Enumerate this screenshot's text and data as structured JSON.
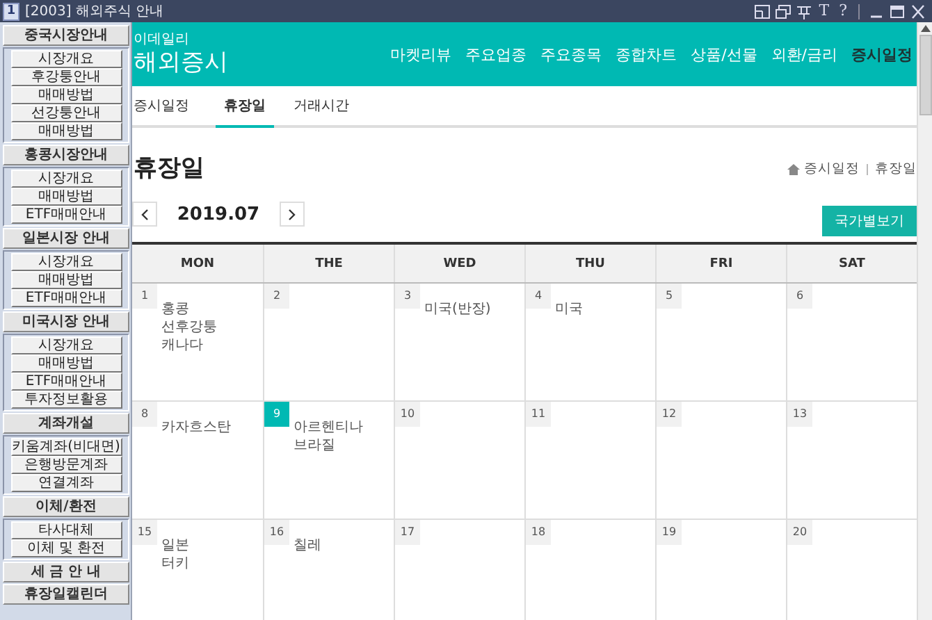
{
  "window": {
    "icon_label": "1",
    "title": "[2003] 해외주식 안내",
    "tool_buttons": [
      "T",
      "?"
    ]
  },
  "sidebar": {
    "sections": [
      {
        "label": "중국시장안내",
        "items": [
          "시장개요",
          "후강퉁안내",
          "매매방법",
          "선강퉁안내",
          "매매방법"
        ]
      },
      {
        "label": "홍콩시장안내",
        "items": [
          "시장개요",
          "매매방법",
          "ETF매매안내"
        ]
      },
      {
        "label": "일본시장 안내",
        "items": [
          "시장개요",
          "매매방법",
          "ETF매매안내"
        ]
      },
      {
        "label": "미국시장 안내",
        "items": [
          "시장개요",
          "매매방법",
          "ETF매매안내",
          "투자정보활용"
        ]
      },
      {
        "label": "계좌개설",
        "items": [
          "키움계좌(비대면)",
          "은행방문계좌",
          "연결계좌"
        ]
      },
      {
        "label": "이체/환전",
        "items": [
          "타사대체",
          "이체 및 환전"
        ]
      },
      {
        "label": "세 금 안 내"
      },
      {
        "label": "휴장일캘린더"
      }
    ]
  },
  "header": {
    "brand_small": "이데일리",
    "brand": "해외증시",
    "nav": [
      {
        "label": "마켓리뷰",
        "selected": false
      },
      {
        "label": "주요업종",
        "selected": false
      },
      {
        "label": "주요종목",
        "selected": false
      },
      {
        "label": "종합차트",
        "selected": false
      },
      {
        "label": "상품/선물",
        "selected": false
      },
      {
        "label": "외환/금리",
        "selected": false
      },
      {
        "label": "증시일정",
        "selected": true
      }
    ]
  },
  "subtabs": [
    {
      "label": "증시일정",
      "selected": false
    },
    {
      "label": "휴장일",
      "selected": true
    },
    {
      "label": "거래시간",
      "selected": false
    }
  ],
  "page_title": "휴장일",
  "breadcrumb": [
    "증시일정",
    "휴장일"
  ],
  "month": "2019.07",
  "country_button": "국가별보기",
  "calendar": {
    "columns": [
      "MON",
      "THE",
      "WED",
      "THU",
      "FRI",
      "SAT"
    ],
    "weeks": [
      [
        {
          "day": "1",
          "today": false,
          "events": [
            "홍콩",
            "선후강퉁",
            "캐나다"
          ]
        },
        {
          "day": "2",
          "today": false
        },
        {
          "day": "3",
          "today": false,
          "events": [
            "미국(반장)"
          ]
        },
        {
          "day": "4",
          "today": false,
          "events": [
            "미국"
          ]
        },
        {
          "day": "5",
          "today": false
        },
        {
          "day": "6",
          "today": false
        }
      ],
      [
        {
          "day": "8",
          "today": false,
          "events": [
            "카자흐스탄"
          ]
        },
        {
          "day": "9",
          "today": true,
          "events": [
            "아르헨티나",
            "브라질"
          ]
        },
        {
          "day": "10",
          "today": false
        },
        {
          "day": "11",
          "today": false
        },
        {
          "day": "12",
          "today": false
        },
        {
          "day": "13",
          "today": false
        }
      ],
      [
        {
          "day": "15",
          "today": false,
          "events": [
            "일본",
            "터키"
          ]
        },
        {
          "day": "16",
          "today": false,
          "events": [
            "칠레"
          ]
        },
        {
          "day": "17",
          "today": false
        },
        {
          "day": "18",
          "today": false
        },
        {
          "day": "19",
          "today": false
        },
        {
          "day": "20",
          "today": false
        }
      ]
    ]
  }
}
